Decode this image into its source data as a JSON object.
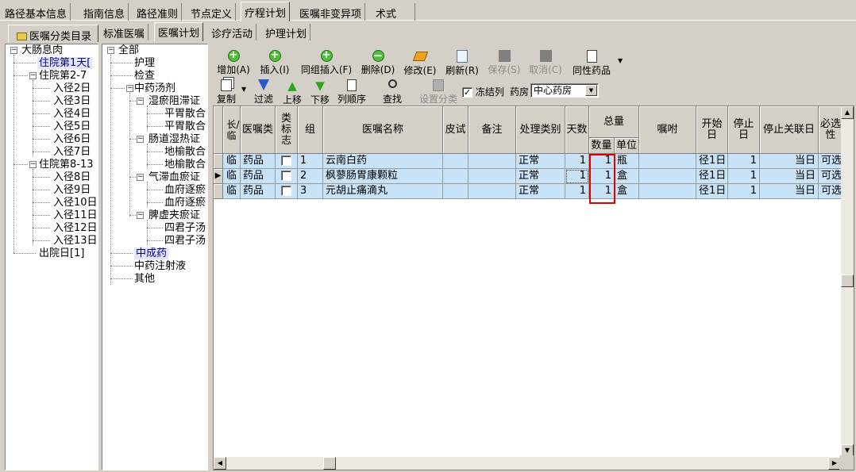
{
  "top_tabs": [
    "路径基本信息",
    "指南信息",
    "路径准则",
    "节点定义",
    "疗程计划",
    "医嘱非变异项",
    "术式"
  ],
  "active_top_tab": "疗程计划",
  "left_tab": "医嘱分类目录",
  "left_tree": {
    "root": "大肠息肉",
    "day1": "住院第1天[",
    "group1": "住院第2-7",
    "group1_children": [
      "入径2日",
      "入径3日",
      "入径4日",
      "入径5日",
      "入径6日",
      "入径7日"
    ],
    "group2": "住院第8-13",
    "group2_children": [
      "入径8日",
      "入径9日",
      "入径10日",
      "入径11日",
      "入径12日",
      "入径13日"
    ],
    "discharge": "出院日[1]"
  },
  "sub_tabs": [
    "标准医嘱",
    "医嘱计划",
    "诊疗活动",
    "护理计划"
  ],
  "active_sub_tab": "医嘱计划",
  "order_tree": {
    "root": "全部",
    "nursing": "护理",
    "exam": "检查",
    "tcm_decoction": "中药汤剂",
    "syndrome1": "湿瘀阻滞证",
    "syndrome1_items": [
      "平胃散合",
      "平胃散合"
    ],
    "syndrome2": "肠道湿热证",
    "syndrome2_items": [
      "地榆散合",
      "地榆散合"
    ],
    "syndrome3": "气滞血瘀证",
    "syndrome3_items": [
      "血府逐瘀",
      "血府逐瘀"
    ],
    "syndrome4": "脾虚夹瘀证",
    "syndrome4_items": [
      "四君子汤",
      "四君子汤"
    ],
    "patent": "中成药",
    "injection": "中药注射液",
    "other": "其他"
  },
  "toolbar1": {
    "add": "增加(A)",
    "insert": "插入(I)",
    "group_insert": "同组插入(F)",
    "delete": "删除(D)",
    "modify": "修改(E)",
    "refresh": "刷新(R)",
    "save": "保存(S)",
    "cancel": "取消(C)",
    "same_drug": "同性药品"
  },
  "toolbar2": {
    "copy": "复制",
    "filter": "过滤",
    "move_up": "上移",
    "move_down": "下移",
    "col_order": "列顺序",
    "find": "查找",
    "set_class": "设置分类",
    "freeze_label": "冻结列",
    "freeze_checked": true,
    "pharmacy_label": "药房",
    "pharmacy_value": "中心药房"
  },
  "grid": {
    "headers": {
      "long_temp": "长/临",
      "order_type": "医嘱类",
      "class_flag": "类标志",
      "group": "组",
      "name": "医嘱名称",
      "skin_test": "皮试",
      "remark": "备注",
      "process_type": "处理类别",
      "days": "天数",
      "total": "总量",
      "qty": "数量",
      "unit": "单位",
      "instruction": "嘱咐",
      "start_day": "开始日",
      "stop_day": "停止日",
      "stop_link_day": "停止关联日",
      "required": "必选性"
    },
    "rows": [
      {
        "long_temp": "临",
        "order_type": "药品",
        "group": "1",
        "name": "云南白药",
        "process_type": "正常",
        "days": "1",
        "qty": "1",
        "unit": "瓶",
        "start_day": "径1日",
        "stop_day": "1",
        "stop_link_day": "当日",
        "required": "可选"
      },
      {
        "long_temp": "临",
        "order_type": "药品",
        "group": "2",
        "name": "枫蓼肠胃康颗粒",
        "process_type": "正常",
        "days": "1",
        "qty": "1",
        "unit": "盒",
        "start_day": "径1日",
        "stop_day": "1",
        "stop_link_day": "当日",
        "required": "可选"
      },
      {
        "long_temp": "临",
        "order_type": "药品",
        "group": "3",
        "name": "元胡止痛滴丸",
        "process_type": "正常",
        "days": "1",
        "qty": "1",
        "unit": "盒",
        "start_day": "径1日",
        "stop_day": "1",
        "stop_link_day": "当日",
        "required": "可选"
      }
    ],
    "current_row_marker": "▶"
  },
  "colors": {
    "window_bg": "#d4d0c8",
    "row_highlight": "#c8e2f8",
    "annotation": "#e00000"
  }
}
